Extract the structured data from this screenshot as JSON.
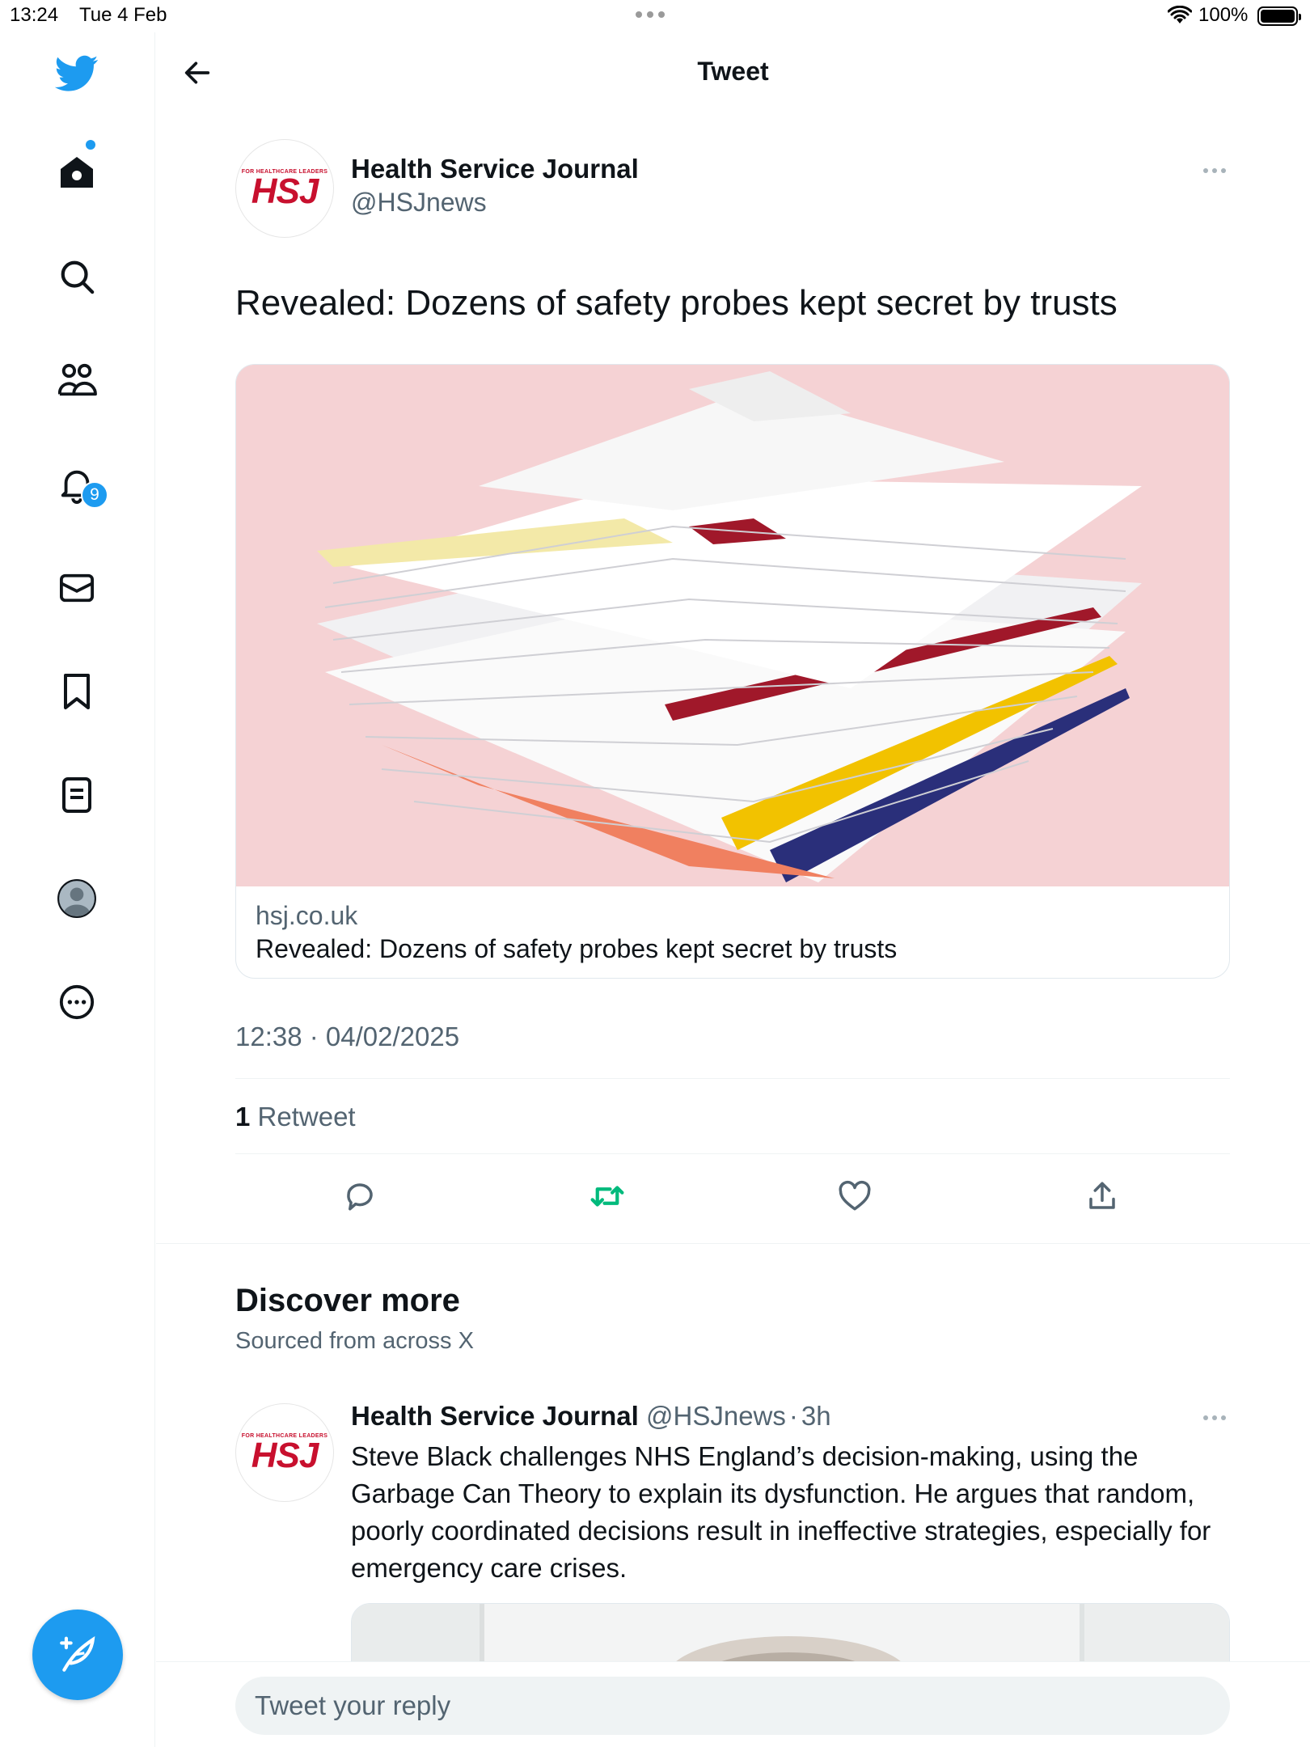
{
  "status_bar": {
    "time": "13:24",
    "date": "Tue 4 Feb",
    "battery": "100%"
  },
  "sidebar": {
    "items": [
      {
        "name": "home",
        "icon": "home-icon"
      },
      {
        "name": "explore",
        "icon": "search-icon"
      },
      {
        "name": "communities",
        "icon": "people-icon"
      },
      {
        "name": "notifications",
        "icon": "bell-icon",
        "badge": "9"
      },
      {
        "name": "messages",
        "icon": "mail-icon"
      },
      {
        "name": "bookmarks",
        "icon": "bookmark-icon"
      },
      {
        "name": "lists",
        "icon": "list-icon"
      },
      {
        "name": "profile",
        "icon": "avatar-icon"
      },
      {
        "name": "more",
        "icon": "more-circle-icon"
      }
    ],
    "compose_icon": "compose-feather-icon"
  },
  "header": {
    "title": "Tweet",
    "back_icon": "arrow-left-icon"
  },
  "tweet": {
    "author_name": "Health Service Journal",
    "author_handle": "@HSJnews",
    "avatar_logo": "HSJ",
    "avatar_tagline": "FOR HEALTHCARE LEADERS",
    "text": "Revealed: Dozens of safety probes kept secret by trusts",
    "card": {
      "domain": "hsj.co.uk",
      "title": "Revealed: Dozens of safety probes kept secret by trusts",
      "image_description_icon": "paper-stack-image"
    },
    "timestamp": "12:38 · 04/02/2025",
    "retweet_count": "1",
    "retweet_label": "Retweet"
  },
  "actions": [
    {
      "name": "reply",
      "icon": "reply-icon"
    },
    {
      "name": "retweet",
      "icon": "retweet-icon"
    },
    {
      "name": "like",
      "icon": "heart-icon"
    },
    {
      "name": "share",
      "icon": "share-icon"
    }
  ],
  "discover": {
    "title": "Discover more",
    "subtitle": "Sourced from across X",
    "post": {
      "author_name": "Health Service Journal",
      "author_handle": "@HSJnews",
      "separator": "·",
      "age": "3h",
      "text": "Steve Black challenges NHS England’s decision-making, using the Garbage Can Theory to explain its dysfunction. He argues that random, poorly coordinated decisions result in ineffective strategies, especially for emergency care crises."
    }
  },
  "reply": {
    "placeholder": "Tweet your reply"
  },
  "colors": {
    "accent": "#1d9bf0",
    "retweet_active": "#00ba7c",
    "text_secondary": "#536471",
    "hsj_red": "#c8102e",
    "card_bg": "#f5d2d4"
  }
}
